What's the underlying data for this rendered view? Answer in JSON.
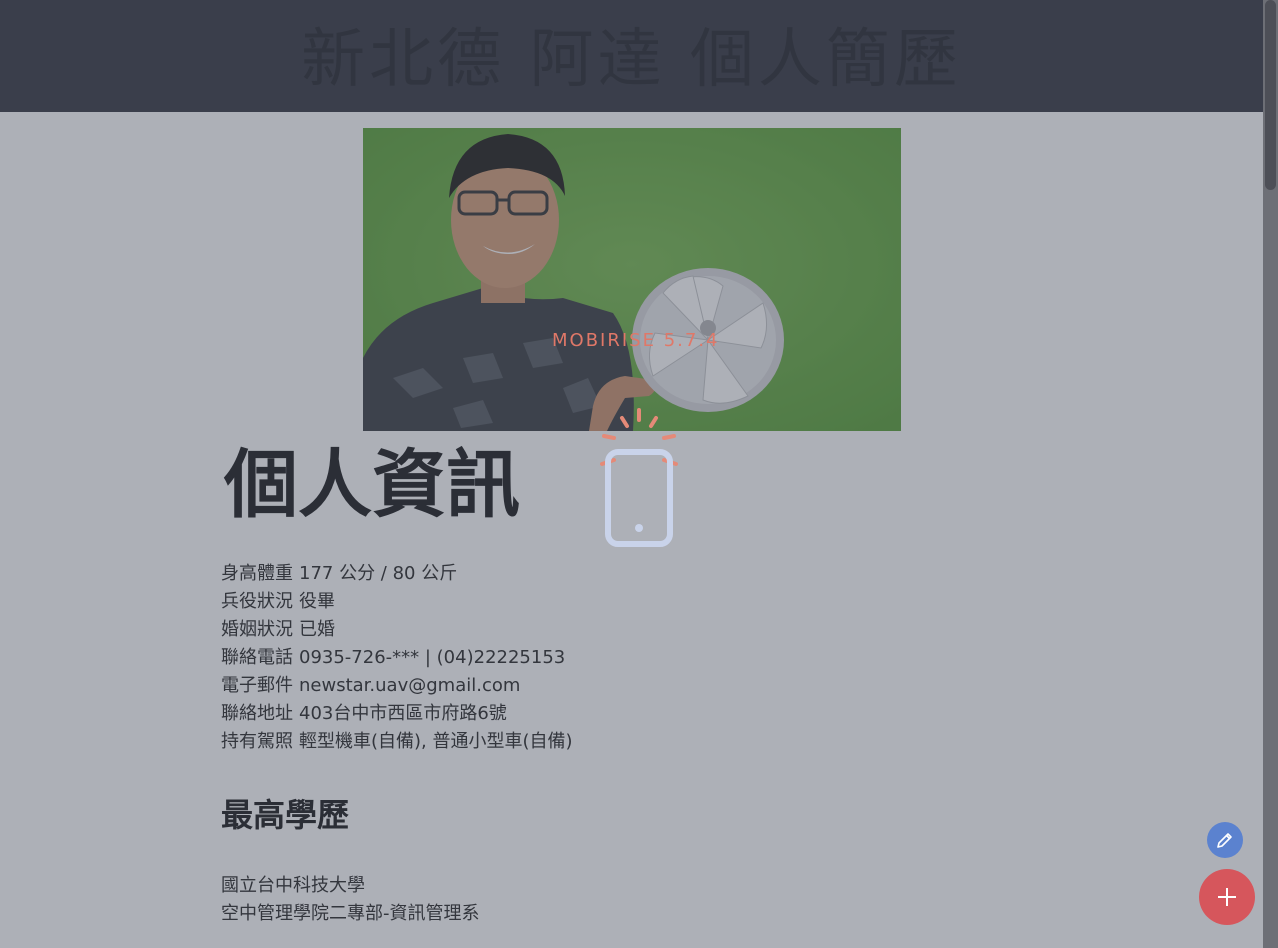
{
  "header": {
    "title": "新北德 阿達 個人簡歷"
  },
  "profile_image": {
    "alt": "photo"
  },
  "personal": {
    "heading": "個人資訊",
    "fields": [
      {
        "label": "身高體重",
        "value": "177 公分 / 80 公斤"
      },
      {
        "label": "兵役狀況",
        "value": "役畢"
      },
      {
        "label": "婚姻狀況",
        "value": "已婚"
      },
      {
        "label": "聯絡電話",
        "value": "0935-726-*** | (04)22225153"
      },
      {
        "label": "電子郵件",
        "value": "newstar.uav@gmail.com"
      },
      {
        "label": "聯絡地址",
        "value": "403台中市西區市府路6號"
      },
      {
        "label": "持有駕照",
        "value": "輕型機車(自備), 普通小型車(自備)"
      }
    ]
  },
  "education": {
    "heading": "最高學歷",
    "lines": [
      "國立台中科技大學",
      "空中管理學院二專部-資訊管理系"
    ]
  },
  "loader": {
    "brand": "MOBIRISE 5.7.4"
  },
  "colors": {
    "topbar": "#3a3c45",
    "overlay": "rgba(60,66,84,0.42)",
    "fab_edit": "#5b82cf",
    "fab_add": "#d6565c",
    "brand_text": "#e07868"
  },
  "icons": {
    "loader": "phone-alert-icon",
    "edit": "pencil-icon",
    "add": "plus-icon"
  }
}
